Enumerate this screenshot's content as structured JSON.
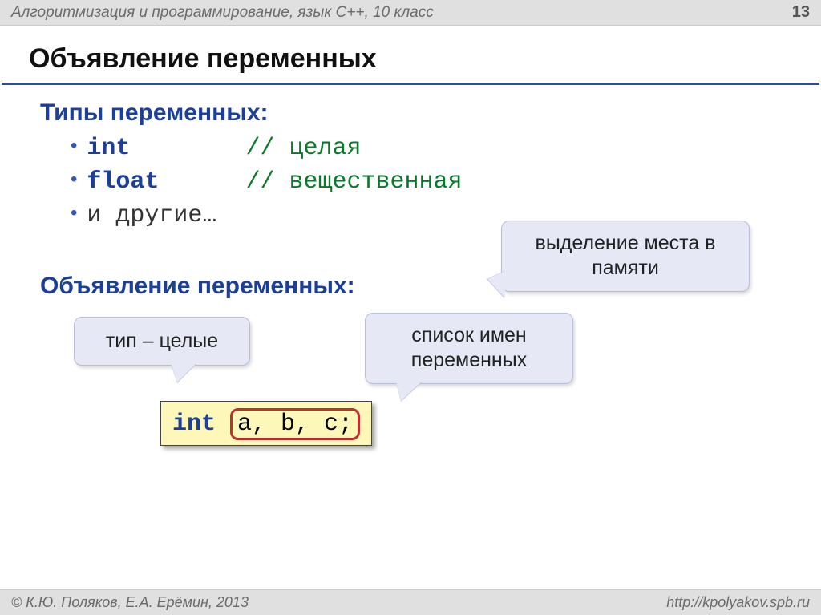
{
  "header": {
    "subject": "Алгоритмизация и программирование, язык  C++, 10 класс",
    "page": "13"
  },
  "title": "Объявление  переменных",
  "types_label": "Типы переменных:",
  "types": {
    "int_kw": "int",
    "int_comment": "// целая",
    "float_kw": "float",
    "float_comment": "// вещественная",
    "others": "и другие…"
  },
  "decl_label": "Объявление переменных:",
  "callouts": {
    "memory": "выделение места в памяти",
    "type": "тип – целые",
    "names": "список имен переменных"
  },
  "code": {
    "kw": "int",
    "vars": "a, b, c;"
  },
  "footer": {
    "copyright": "© К.Ю. Поляков, Е.А. Ерёмин, 2013",
    "url": "http://kpolyakov.spb.ru"
  }
}
